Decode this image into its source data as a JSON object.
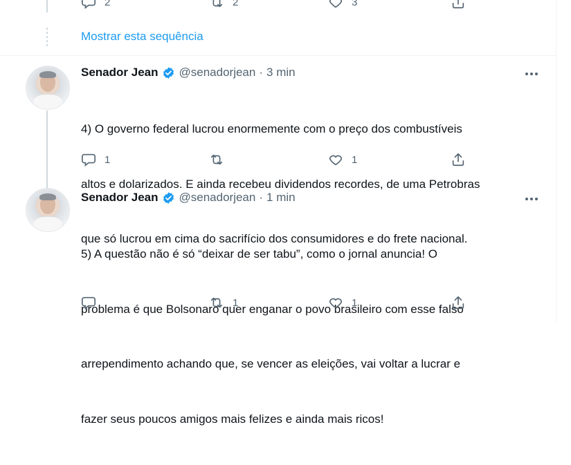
{
  "top_actions": {
    "reply_count": "2",
    "retweet_count": "2",
    "like_count": "3"
  },
  "show_thread_label": "Mostrar esta sequência",
  "tweets": [
    {
      "name": "Senador Jean",
      "handle": "@senadorjean",
      "dot": "·",
      "time": "3 min",
      "text_lines": [
        "4) O governo federal lucrou enormemente com o preço dos combustíveis",
        "altos e dolarizados. E ainda recebeu dividendos recordes, de uma Petrobras",
        "que só lucrou em cima do sacrifício dos consumidores e do frete nacional."
      ],
      "reply_count": "1",
      "retweet_count": "",
      "like_count": "1"
    },
    {
      "name": "Senador Jean",
      "handle": "@senadorjean",
      "dot": "·",
      "time": "1 min",
      "text_lines": [
        "5) A questão não é só “deixar de ser tabu”, como o jornal anuncia! O",
        "problema é que Bolsonaro quer enganar o povo brasileiro com esse falso",
        "arrependimento achando que, se vencer as eleições, vai voltar a lucrar e",
        "fazer seus poucos amigos mais felizes e ainda mais ricos!"
      ],
      "reply_count": "",
      "retweet_count": "1",
      "like_count": "1"
    }
  ],
  "colors": {
    "accent": "#1d9bf0",
    "muted": "#536471",
    "thread_line": "#cfd9de",
    "verified": "#1d9bf0"
  },
  "icons": [
    "reply-icon",
    "retweet-icon",
    "like-icon",
    "share-icon",
    "verified-icon",
    "more-icon"
  ]
}
